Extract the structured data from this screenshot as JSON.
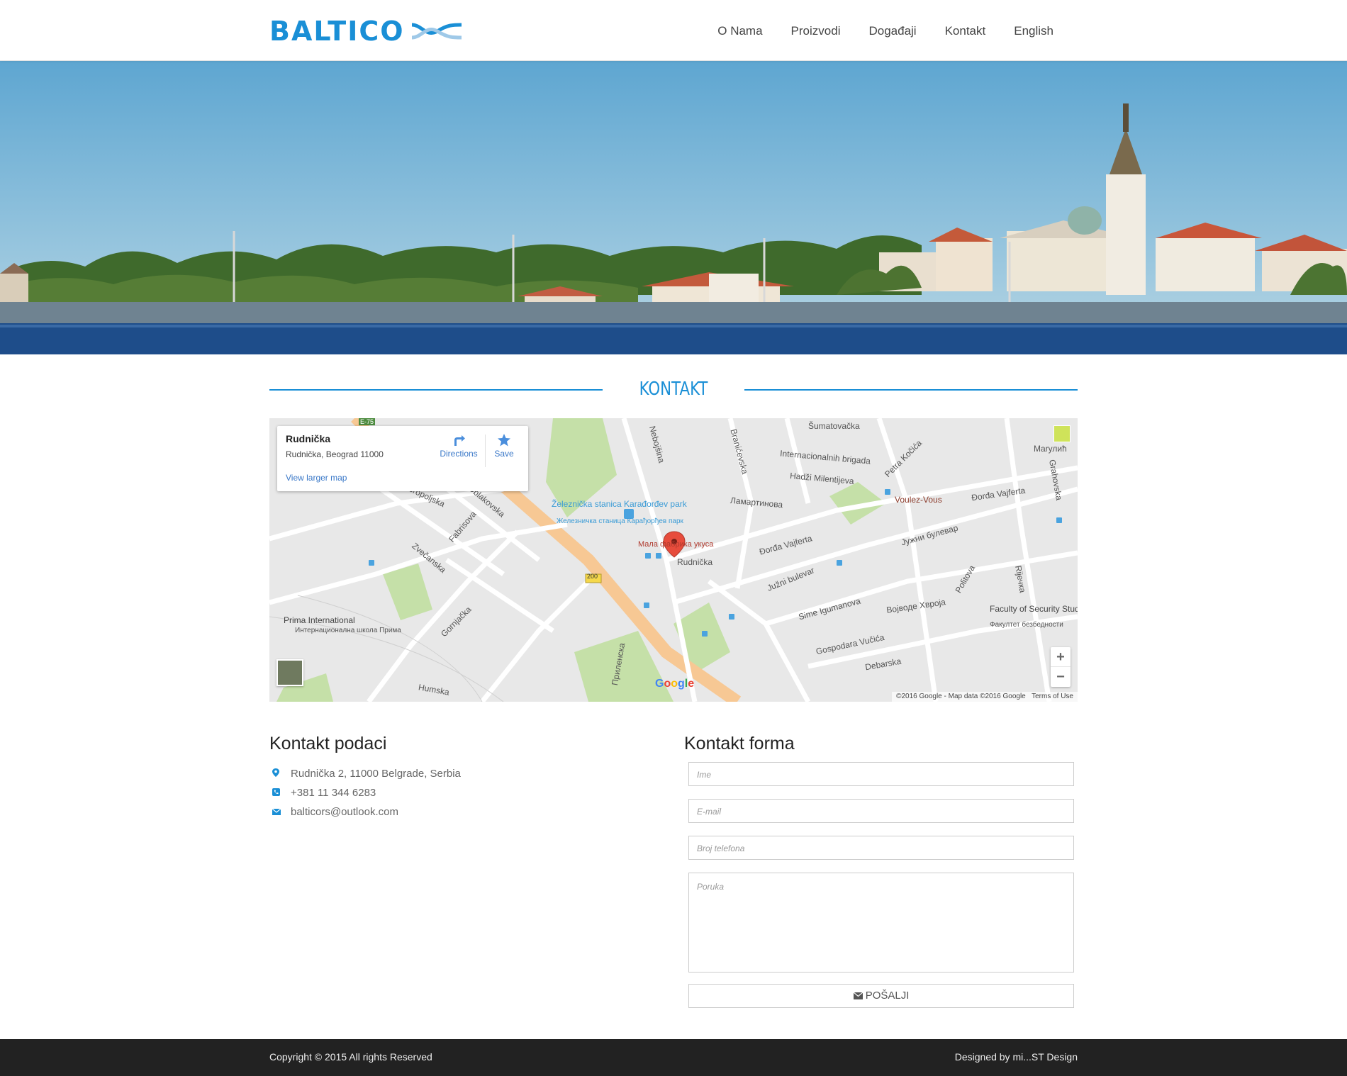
{
  "header": {
    "logo_text": "BALTICO",
    "nav": [
      "O Nama",
      "Proizvodi",
      "Događaji",
      "Kontakt",
      "English"
    ]
  },
  "hero": {
    "image": "belgrade-skyline-photo"
  },
  "section": {
    "title": "KONTAKT"
  },
  "map": {
    "place_name": "Rudnička",
    "place_address": "Rudnička, Beograd 11000",
    "view_larger": "View larger map",
    "directions": "Directions",
    "save": "Save",
    "zoom_in": "+",
    "zoom_out": "−",
    "attribution": "©2016 Google - Map data ©2016 Google",
    "terms": "Terms of Use",
    "google": "Google",
    "labels": [
      "Šumatovačka",
      "Internacionalnih brigada",
      "Hadži Milentijeva",
      "Ламартинова",
      "Voulez-Vous",
      "Đorđa Vajferta",
      "Železnička stanica Karađorđev park",
      "Железничка станица Карађорђев парк",
      "Мала фабрика укуса",
      "Rudnička",
      "Đorđa Vajferta",
      "Јужни булевар",
      "Južni bulevar",
      "Sime Igumanova",
      "Војводе Хврoја",
      "Faculty of Security Studies",
      "Факултет безбедности",
      "Prima International",
      "Интернационална школа Прима",
      "Dobropoljska",
      "Oblakovska",
      "Zvečanska",
      "Fabrisova",
      "Gornjačka",
      "Приленска",
      "Gospodara Vučića",
      "Debarska",
      "Humska",
      "Nebojšina",
      "Branićevska",
      "Petra Kočića",
      "Grahovska",
      "Marулић",
      "Politova",
      "Rijечка",
      "200",
      "E-75"
    ]
  },
  "contact_info": {
    "title": "Kontakt podaci",
    "address": "Rudnička 2, 11000 Belgrade, Serbia",
    "phone": "+381 11 344 6283",
    "email": "balticors@outlook.com",
    "icons": [
      "map-pin-icon",
      "phone-icon",
      "envelope-icon"
    ]
  },
  "form": {
    "title": "Kontakt forma",
    "name_placeholder": "Ime",
    "email_placeholder": "E-mail",
    "phone_placeholder": "Broj telefona",
    "message_placeholder": "Poruka",
    "submit": "POŠALJI"
  },
  "footer": {
    "copyright": "Copyright © 2015 All rights Reserved",
    "designer": "Designed by mi...ST Design"
  },
  "colors": {
    "accent": "#1a8fd6",
    "footer": "#222222"
  }
}
